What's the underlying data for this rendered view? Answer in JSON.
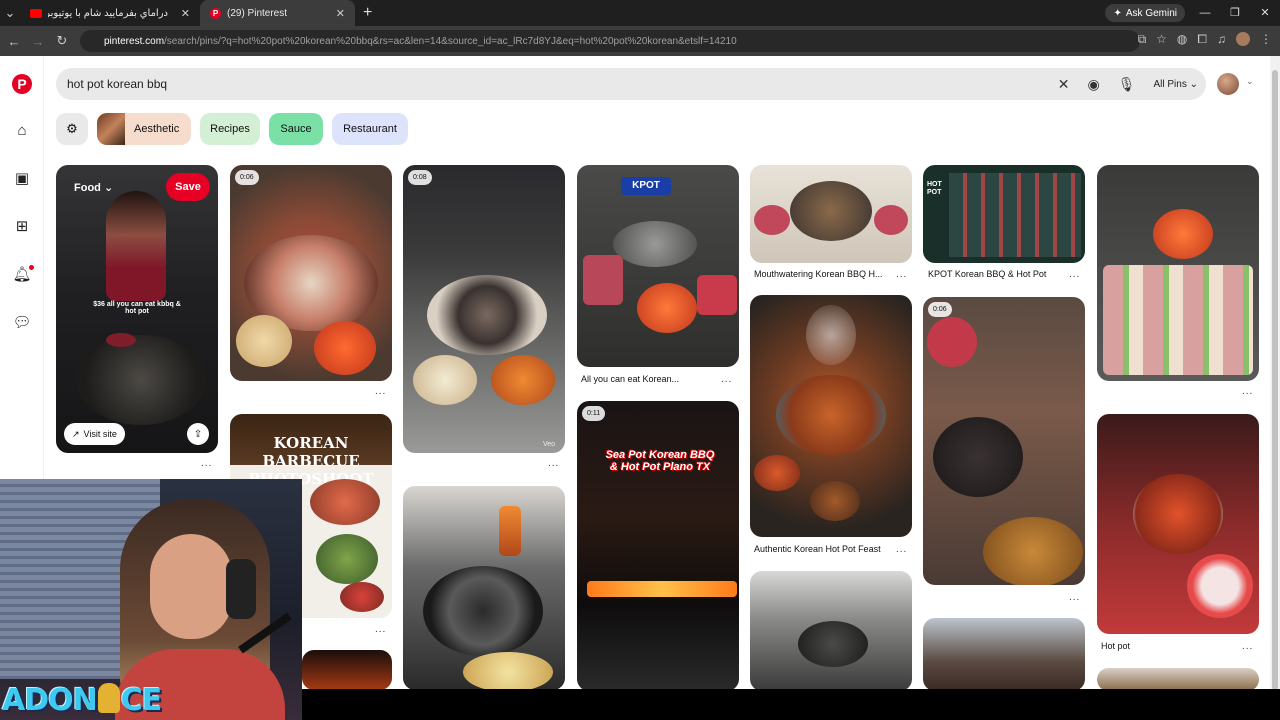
{
  "browser": {
    "tabs": [
      {
        "title": "دراماي بفرمایید شام با یوتیوبرها و",
        "active": false
      },
      {
        "title": "(29) Pinterest",
        "active": true
      }
    ],
    "gemini_label": "Ask Gemini",
    "url_domain": "pinterest.com",
    "url_path": "/search/pins/?q=hot%20pot%20korean%20bbq&rs=ac&len=14&source_id=ac_lRc7d8YJ&eq=hot%20pot%20korean&etslf=14210"
  },
  "pinterest": {
    "search": {
      "value": "hot pot korean bbq",
      "scope": "All Pins"
    },
    "chips": [
      "Aesthetic",
      "Recipes",
      "Sauce",
      "Restaurant"
    ],
    "hover_pin": {
      "board": "Food",
      "save_label": "Save",
      "overlay_text": "$36 all you can eat kbbq & hot pot",
      "visit_label": "Visit site"
    },
    "video_durations": {
      "p2": "0:06",
      "p3": "0:08",
      "p11": "0:11",
      "p12": "0:06"
    },
    "captions": {
      "all_you_can_eat": "All you can eat Korean...",
      "mouthwatering": "Mouthwatering Korean BBQ H...",
      "kpot": "KPOT Korean BBQ & Hot Pot",
      "authentic": "Authentic Korean Hot Pot Feast",
      "hot_pot": "Hot pot"
    },
    "overlays": {
      "photoshoot": "KOREAN BARBECUE PHOTOSHOOT",
      "seapot": "Sea Pot Korean BBQ & Hot Pot Plano TX",
      "kpot_sign": "KPOT",
      "kpot_menu": "HOT POT",
      "veo": "Veo"
    },
    "more_label": "...",
    "notification_dot": true
  },
  "stream": {
    "brand": [
      "AD",
      "O",
      "N",
      "I",
      "CE"
    ]
  },
  "colors": {
    "pinterest_red": "#e60023",
    "chrome_dark": "#1f1f1f"
  }
}
